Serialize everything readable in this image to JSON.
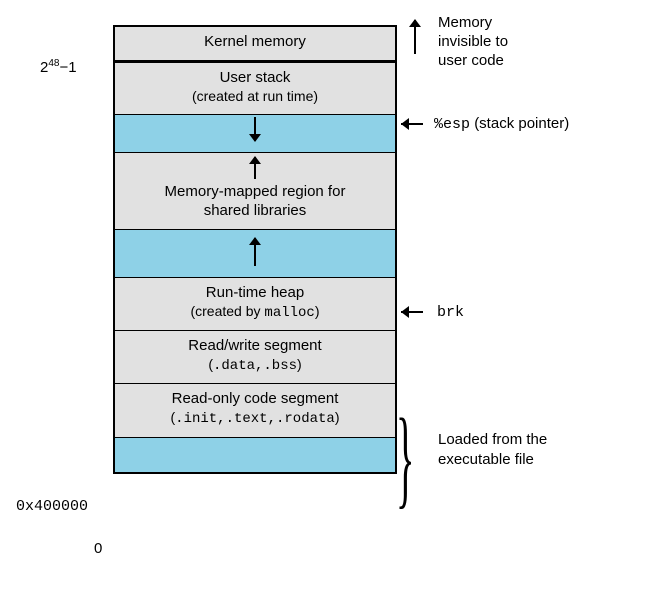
{
  "segments": {
    "kernel": "Kernel memory",
    "user_stack_l1": "User stack",
    "user_stack_l2": "(created at run time)",
    "mmap_l1": "Memory-mapped region for",
    "mmap_l2": "shared libraries",
    "heap_l1": "Run-time heap",
    "heap_l2_pre": "(created by ",
    "heap_l2_code": "malloc",
    "heap_l2_post": ")",
    "rw_l1": "Read/write segment",
    "rw_l2_pre": "(",
    "rw_l2_code": ".data,.bss",
    "rw_l2_post": ")",
    "ro_l1": "Read-only code segment",
    "ro_l2_pre": "(",
    "ro_l2_code": ".init,.text,.rodata",
    "ro_l2_post": ")"
  },
  "annotations": {
    "kernel_note_l1": "Memory",
    "kernel_note_l2": "invisible to",
    "kernel_note_l3": "user code",
    "esp_code": "%esp",
    "esp_note": "(stack pointer)",
    "brk": "brk",
    "loaded_l1": "Loaded from the",
    "loaded_l2": "executable file"
  },
  "addresses": {
    "top_base": "2",
    "top_exp": "48",
    "top_minus": "−1",
    "bottom": "0x400000",
    "zero": "0"
  }
}
